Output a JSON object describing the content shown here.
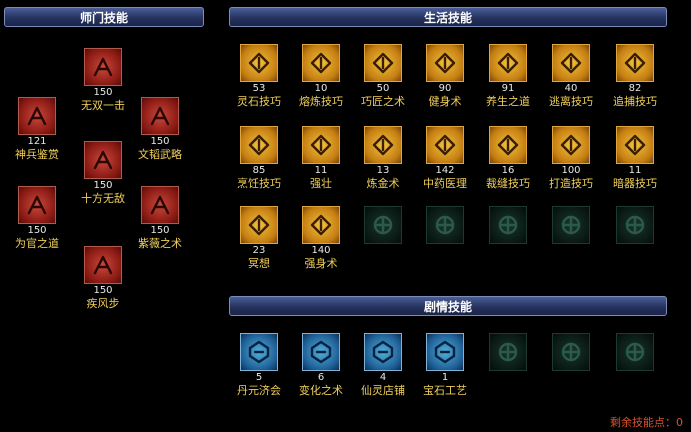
{
  "sections": {
    "school": "师门技能",
    "life": "生活技能",
    "plot": "剧情技能"
  },
  "school_skills": [
    {
      "name": "无双一击",
      "level": "150",
      "icon": "blade-burst-icon"
    },
    {
      "name": "神兵鉴赏",
      "level": "121",
      "icon": "weapon-appraise-icon"
    },
    {
      "name": "文韬武略",
      "level": "150",
      "icon": "gate-scroll-icon"
    },
    {
      "name": "十方无敌",
      "level": "150",
      "icon": "crossed-swords-icon"
    },
    {
      "name": "为官之道",
      "level": "150",
      "icon": "official-path-icon"
    },
    {
      "name": "紫薇之术",
      "level": "150",
      "icon": "star-art-icon"
    },
    {
      "name": "疾风步",
      "level": "150",
      "icon": "wind-step-icon"
    }
  ],
  "life_skills": [
    {
      "name": "灵石技巧",
      "level": "53",
      "icon": "spirit-stone-icon"
    },
    {
      "name": "熔炼技巧",
      "level": "10",
      "icon": "smelting-icon"
    },
    {
      "name": "巧匠之术",
      "level": "50",
      "icon": "craftsman-icon"
    },
    {
      "name": "健身术",
      "level": "90",
      "icon": "fitness-icon"
    },
    {
      "name": "养生之道",
      "level": "91",
      "icon": "health-icon"
    },
    {
      "name": "逃离技巧",
      "level": "40",
      "icon": "escape-icon"
    },
    {
      "name": "追捕技巧",
      "level": "82",
      "icon": "chase-icon"
    },
    {
      "name": "烹饪技巧",
      "level": "85",
      "icon": "cooking-icon"
    },
    {
      "name": "强壮",
      "level": "11",
      "icon": "strength-icon"
    },
    {
      "name": "炼金术",
      "level": "13",
      "icon": "alchemy-icon"
    },
    {
      "name": "中药医理",
      "level": "142",
      "icon": "medicine-icon"
    },
    {
      "name": "裁缝技巧",
      "level": "16",
      "icon": "tailoring-icon"
    },
    {
      "name": "打造技巧",
      "level": "100",
      "icon": "forging-icon"
    },
    {
      "name": "暗器技巧",
      "level": "11",
      "icon": "hidden-weapon-icon"
    },
    {
      "name": "冥想",
      "level": "23",
      "icon": "meditation-icon"
    },
    {
      "name": "强身术",
      "level": "140",
      "icon": "body-strength-icon"
    }
  ],
  "life_empty_slots": 5,
  "plot_skills": [
    {
      "name": "丹元济会",
      "level": "5",
      "icon": "elixir-icon"
    },
    {
      "name": "变化之术",
      "level": "6",
      "icon": "transform-icon"
    },
    {
      "name": "仙灵店铺",
      "level": "4",
      "icon": "fairy-shop-icon"
    },
    {
      "name": "宝石工艺",
      "level": "1",
      "icon": "gem-craft-icon"
    }
  ],
  "plot_empty_slots": 3,
  "remaining_points": "剩余技能点：0",
  "colors": {
    "school": "#b2302a",
    "life": "#d89a22",
    "plot": "#2f86c2",
    "empty": "#0f2820",
    "label": "#f0cf5a",
    "remain": "#d8542e"
  }
}
